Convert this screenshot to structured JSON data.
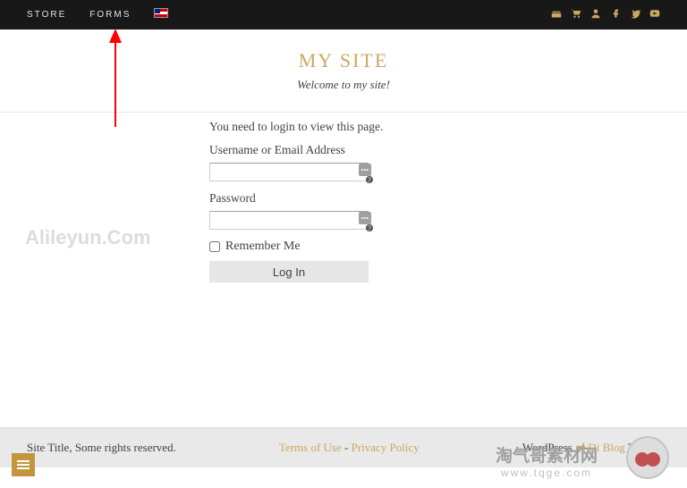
{
  "topnav": {
    "store": "STORE",
    "forms": "FORMS"
  },
  "header": {
    "title": "MY SITE",
    "tagline": "Welcome to my site!"
  },
  "login": {
    "notice": "You need to login to view this page.",
    "username_label": "Username or Email Address",
    "password_label": "Password",
    "remember_label": "Remember Me",
    "button": "Log In"
  },
  "watermark": "Alileyun.Com",
  "footer": {
    "left": "Site Title, Some rights reserved.",
    "terms": "Terms of Use",
    "sep": " - ",
    "privacy": "Privacy Policy",
    "wp": "WordPress ",
    "theme_link": "Di Blog",
    "theme_suffix": " Theme"
  },
  "bottom_brand": {
    "cn": "淘气哥素材网",
    "url": "www.tqge.com"
  }
}
